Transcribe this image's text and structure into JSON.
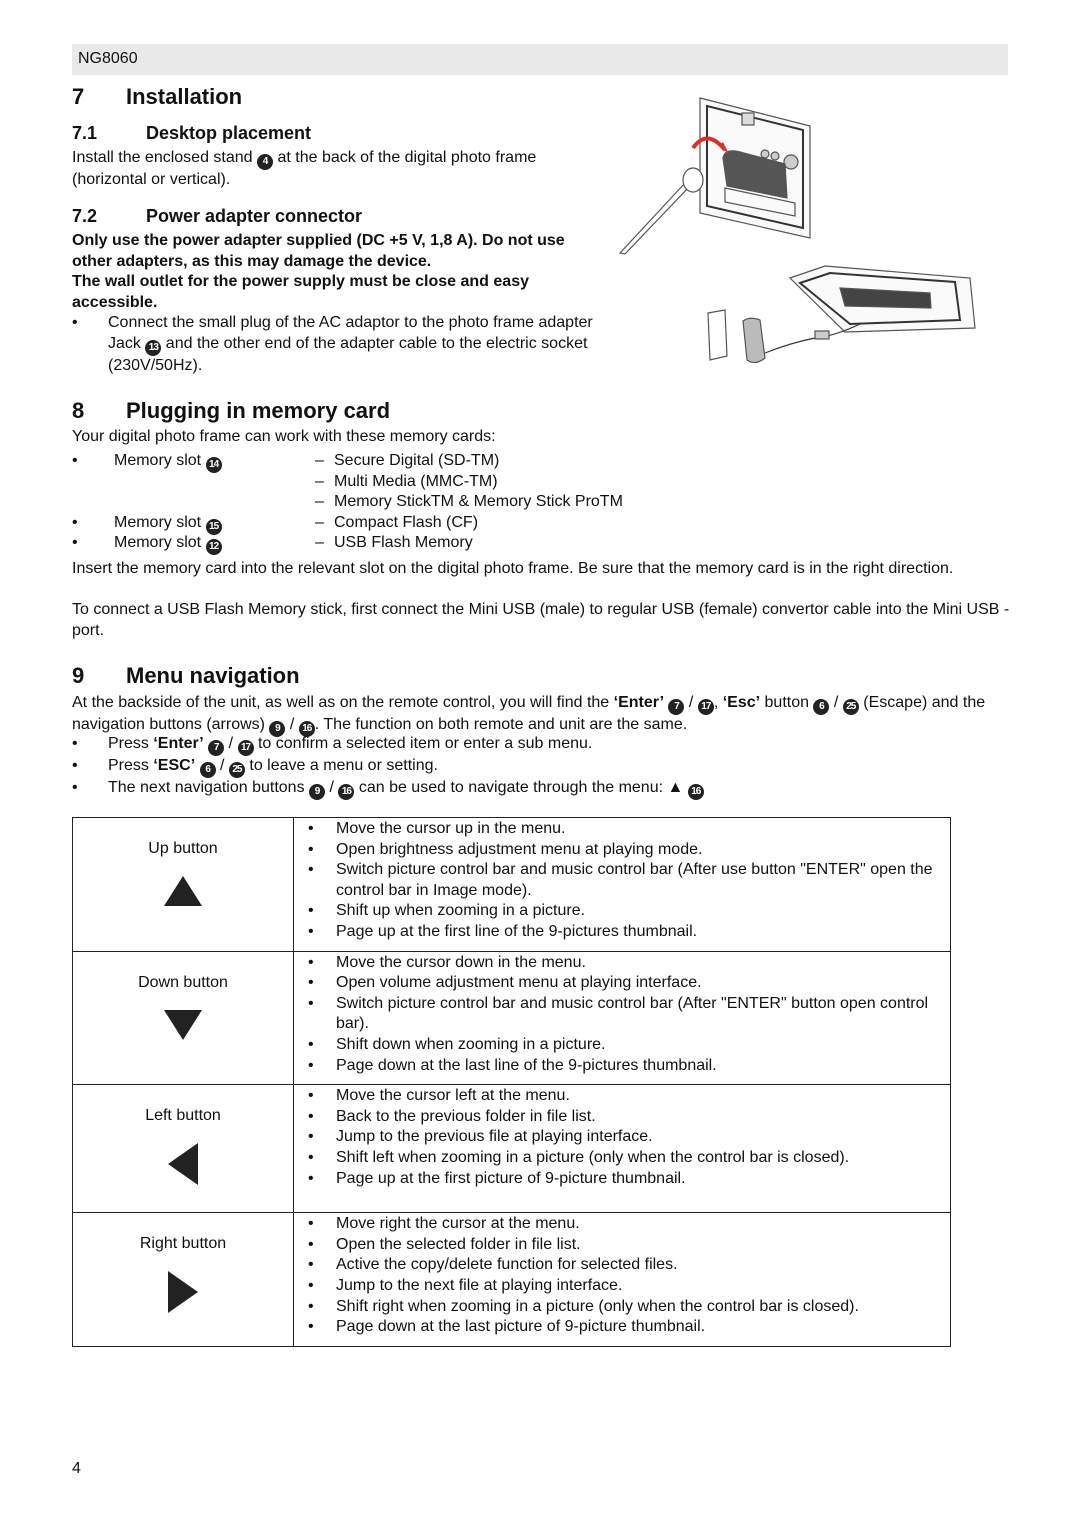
{
  "header": {
    "model": "NG8060"
  },
  "s7": {
    "num": "7",
    "title": "Installation",
    "s71": {
      "num": "7.1",
      "title": "Desktop placement",
      "text_a": "Install the enclosed stand",
      "badge": "4",
      "text_b": " at the back of the digital photo frame (horizontal or vertical)."
    },
    "s72": {
      "num": "7.2",
      "title": "Power adapter connector",
      "warning1": "Only use the power adapter supplied (DC +5 V, 1,8 A). Do not use other adapters, as this may damage the device.",
      "warning2": "The wall outlet for the power supply must be close and easy accessible.",
      "bullet_a": "Connect the small plug of the AC adaptor to the photo frame adapter Jack",
      "badge": "13",
      "bullet_b": " and the other end of the adapter cable to the electric socket (230V/50Hz)."
    }
  },
  "s8": {
    "num": "8",
    "title": "Plugging in memory card",
    "intro": "Your digital photo frame can work with these memory cards:",
    "slots": [
      {
        "label": "Memory slot",
        "badge": "14",
        "cards": [
          "Secure Digital (SD-TM)",
          "Multi Media (MMC-TM)",
          "Memory StickTM & Memory Stick ProTM"
        ]
      },
      {
        "label": "Memory slot",
        "badge": "15",
        "cards": [
          "Compact Flash (CF)"
        ]
      },
      {
        "label": "Memory slot",
        "badge": "12",
        "cards": [
          "USB Flash Memory"
        ]
      }
    ],
    "para1": "Insert the memory card into the relevant slot on the digital photo frame. Be sure that the memory card is in the right direction.",
    "para2": "To connect a USB Flash Memory stick, first connect the Mini USB (male) to regular USB (female) convertor cable into the Mini USB - port."
  },
  "s9": {
    "num": "9",
    "title": "Menu navigation",
    "intro": {
      "t1": "At the backside of the unit, as well as on the remote control, you will find the ",
      "enter": "‘Enter’",
      "b7": "7",
      "slash": "/",
      "b17": "17",
      "comma": ", ",
      "esc": "‘Esc’",
      "t2": " button ",
      "b6": "6",
      "b25": "25",
      "t3": "(Escape) and the navigation buttons (arrows) ",
      "b9": "9",
      "b16": "16",
      "t4": ". The function on both remote and unit are the same."
    },
    "bullets": [
      {
        "pre": "Press ",
        "key": "‘Enter’",
        "ba": "7",
        "bb": "17",
        "post": " to confirm a selected item or enter a sub menu."
      },
      {
        "pre": "Press ",
        "key": "‘ESC’",
        "ba": "6",
        "bb": "25",
        "post": " to leave a menu or setting."
      },
      {
        "pre": "The next navigation buttons ",
        "key": "",
        "ba": "9",
        "bb": "16",
        "post": " can be used to navigate through the menu: ",
        "arrow": "▲",
        "bc": "16"
      }
    ],
    "table": [
      {
        "label": "Up button",
        "icon": "up-arrow-icon",
        "items": [
          "Move the cursor up in the menu.",
          "Open brightness adjustment menu at playing mode.",
          "Switch picture control bar and music control bar (After use button \"ENTER\" open the control bar in Image mode).",
          "Shift up when zooming in a picture.",
          "Page up at the first line of the 9-pictures thumbnail."
        ]
      },
      {
        "label": "Down button",
        "icon": "down-arrow-icon",
        "items": [
          "Move the cursor down in the menu.",
          "Open volume adjustment menu at playing interface.",
          "Switch picture control bar and music control bar (After \"ENTER\" button open control bar).",
          "Shift down when zooming in a picture.",
          "Page down at the last line of the 9-pictures thumbnail."
        ]
      },
      {
        "label": "Left button",
        "icon": "left-arrow-icon",
        "items": [
          "Move the cursor left at the menu.",
          "Back to the previous folder in file list.",
          "Jump to the previous file at playing interface.",
          "Shift left when zooming in a picture (only when the control bar is closed).",
          "Page up at the first picture of 9-picture thumbnail."
        ]
      },
      {
        "label": "Right button",
        "icon": "right-arrow-icon",
        "items": [
          "Move right the cursor at the menu.",
          "Open the selected folder in file list.",
          "Active the copy/delete function for selected files.",
          "Jump to the next file at playing interface.",
          "Shift right when zooming in a picture (only when the control bar is closed).",
          "Page down at the last picture of 9-picture thumbnail."
        ]
      }
    ]
  },
  "footer": {
    "page": "4"
  },
  "colors": {
    "header_bg": "#e9e9e9",
    "text": "#111111",
    "stand_arrow": "#d9302b"
  }
}
